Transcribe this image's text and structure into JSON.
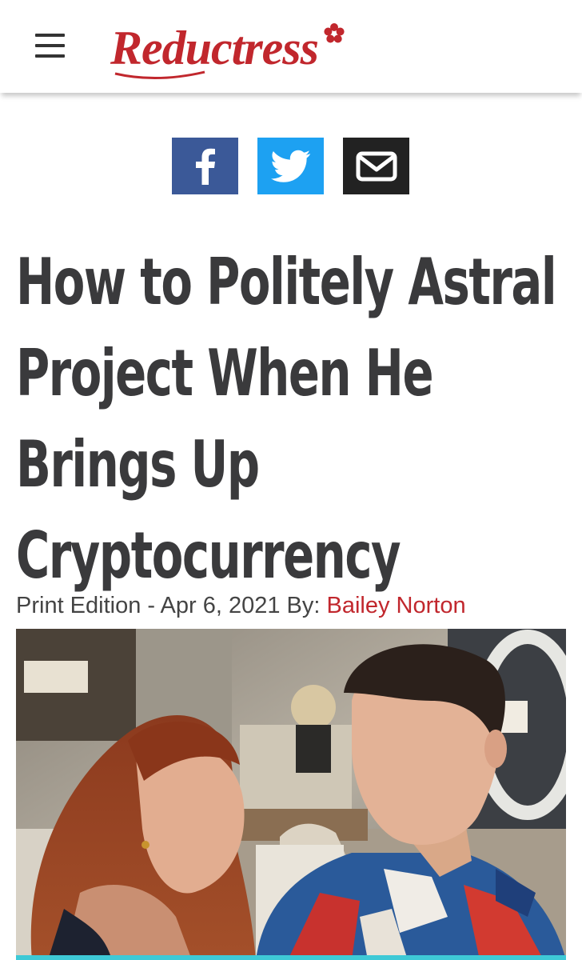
{
  "header": {
    "menu_icon": "hamburger-menu-icon",
    "logo_text": "Reductress",
    "logo_color": "#c1272d"
  },
  "share": {
    "facebook_icon": "facebook-icon",
    "twitter_icon": "twitter-icon",
    "email_icon": "envelope-icon",
    "colors": {
      "facebook": "#3b5998",
      "twitter": "#1da1f2",
      "email": "#222222"
    }
  },
  "article": {
    "headline_lines": [
      "How to Politely Astral",
      "Project When He",
      "Brings Up",
      "Cryptocurrency"
    ],
    "byline_prefix": "Print Edition - Apr 6, 2021 By: ",
    "author": "Bailey Norton"
  }
}
